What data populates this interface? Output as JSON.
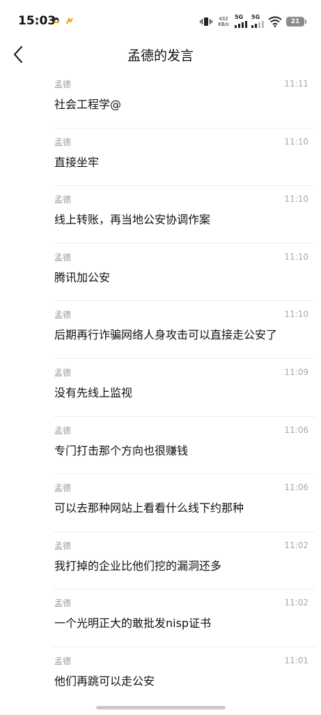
{
  "status_bar": {
    "time": "15:03",
    "speed_value": "432",
    "speed_unit": "KB/s",
    "net1": "5G",
    "net2": "5G",
    "battery": "21"
  },
  "header": {
    "title": "孟德的发言"
  },
  "messages": [
    {
      "sender": "孟德",
      "time": "11:11",
      "text": "社会工程学@"
    },
    {
      "sender": "孟德",
      "time": "11:10",
      "text": "直接坐牢"
    },
    {
      "sender": "孟德",
      "time": "11:10",
      "text": "线上转账，再当地公安协调作案"
    },
    {
      "sender": "孟德",
      "time": "11:10",
      "text": "腾讯加公安"
    },
    {
      "sender": "孟德",
      "time": "11:10",
      "text": "后期再行诈骗网络人身攻击可以直接走公安了"
    },
    {
      "sender": "孟德",
      "time": "11:09",
      "text": "没有先线上监视"
    },
    {
      "sender": "孟德",
      "time": "11:06",
      "text": "专门打击那个方向也很赚钱"
    },
    {
      "sender": "孟德",
      "time": "11:06",
      "text": "可以去那种网站上看看什么线下约那种"
    },
    {
      "sender": "孟德",
      "time": "11:02",
      "text": "我打掉的企业比他们挖的漏洞还多"
    },
    {
      "sender": "孟德",
      "time": "11:02",
      "text": "一个光明正大的敢批发nisp证书"
    },
    {
      "sender": "孟德",
      "time": "11:01",
      "text": "他们再跳可以走公安"
    }
  ]
}
